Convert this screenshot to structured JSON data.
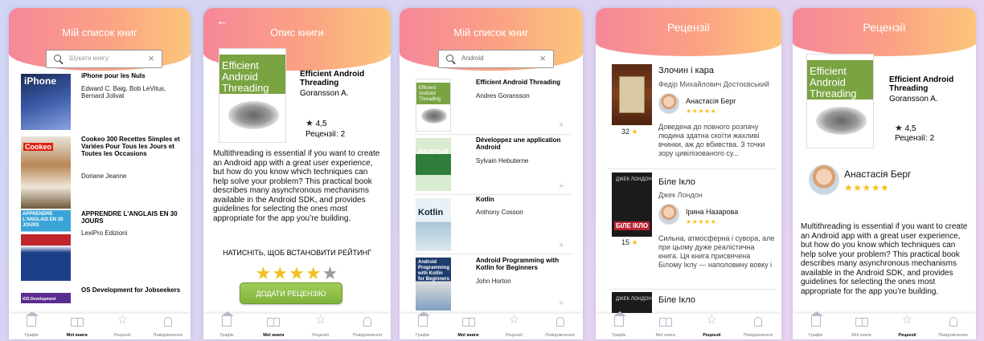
{
  "nav": {
    "items": [
      "Графік",
      "Мої книги",
      "Рецензії",
      "Повідомлення"
    ]
  },
  "screen1": {
    "title": "Мій список книг",
    "search_placeholder": "Шукати книгу",
    "books": [
      {
        "title": "iPhone pour les Nuls",
        "author": "Edward C. Baig, Bob LeVitus, Bernard Jolivat",
        "cover_text": "iPhone"
      },
      {
        "title": "Cookeo 300 Recettes Simples et Variées Pour Tous les Jours et Toutes les Occasions",
        "author": "Doriane Jeanne",
        "cover_text": "Cookeo"
      },
      {
        "title": "APPRENDRE L'ANGLAIS EN 30 JOURS",
        "author": "LexiPro Edizioni",
        "cover_text": "APPRENDRE L'ANGLAIS EN 30 JOURS"
      },
      {
        "title": "OS Development for Jobseekers",
        "author": "",
        "cover_text": "iOS Development"
      }
    ]
  },
  "screen2": {
    "title": "Опис книги",
    "back_icon": "arrow-left-icon",
    "book_title": "Efficient Android Threading",
    "book_author": "Goransson A.",
    "cover_text": "Efficient Android Threading",
    "rating": "4,5",
    "reviews_label": "Рецензії: 2",
    "description": "Multithreading is essential if you want to create an Android app with a great user experience, but how do you know which techniques can help solve your problem? This practical book describes many asynchronous mechanisms available in the Android SDK, and provides guidelines for selecting the ones most appropriate for the app you’re building.",
    "set_rating_label": "НАТИСНІТЬ, ЩОБ ВСТАНОВИТИ РЕЙТИНГ",
    "user_rating": 4,
    "max_rating": 5,
    "add_review_button": "ДОДАТИ РЕЦЕНЗІЮ"
  },
  "screen3": {
    "title": "Мій список книг",
    "search_value": "Android",
    "results": [
      {
        "title": "Efficient Android Threading",
        "author": "Andres Goransson",
        "cover_text": "Efficient Android Threading"
      },
      {
        "title": "Développez une application Android",
        "author": "Sylvain Hebuterne",
        "cover_text": "Android"
      },
      {
        "title": "Kotlin",
        "author": "Anthony Cosson",
        "cover_text": "Kotlin"
      },
      {
        "title": "Android Programming with Kotlin for Beginners",
        "author": "John Horton",
        "cover_text": "Android Programming with Kotlin for Beginners"
      }
    ]
  },
  "screen4": {
    "title": "Рецензії",
    "reviews": [
      {
        "book": "Злочин і кара",
        "author": "Федір Михайлович Достоєвський",
        "reviewer": "Анастасія Берг",
        "stars": "★★★★★",
        "count": "32",
        "text": "Доведена до повного розпачу людина здатна скоїти жахливі вчинки, аж до вбивства. З точки зору цивілізованого су..."
      },
      {
        "book": "Біле Ікло",
        "author": "Джек Лондон",
        "reviewer": "Ірина Назарова",
        "stars": "★★★★★",
        "count": "15",
        "text": "Сильна, атмосферна і сувора, але при цьому дуже реалістична книга. Ця книга присвячена Білому Іклу — наполовину вовку і"
      },
      {
        "book": "Біле Ікло",
        "author": "",
        "reviewer": "",
        "stars": "",
        "count": "",
        "text": ""
      }
    ],
    "cover_texts": [
      "ДЖЕК ЛОНДОН",
      "БІЛЕ ІКЛО",
      "ДЖЕК ЛОНДОН"
    ]
  },
  "screen5": {
    "title": "Рецензії",
    "book_title": "Efficient Android Threading",
    "book_author": "Goransson A.",
    "cover_text": "Efficient Android Threading",
    "rating": "4,5",
    "reviews_label": "Рецензії: 2",
    "reviewer": "Анастасія Берг",
    "stars": "★★★★★",
    "description": "Multithreading is essential if you want to create an Android app with a great user experience, but how do you know which techniques can help solve your problem? This practical book describes many asynchronous mechanisms available in the Android SDK, and provides guidelines for selecting the ones most appropriate for the app you’re building."
  },
  "colors": {
    "header_start": "#f6879a",
    "header_end": "#fcc57b",
    "star": "#f4c020",
    "button": "#8dc04a"
  }
}
